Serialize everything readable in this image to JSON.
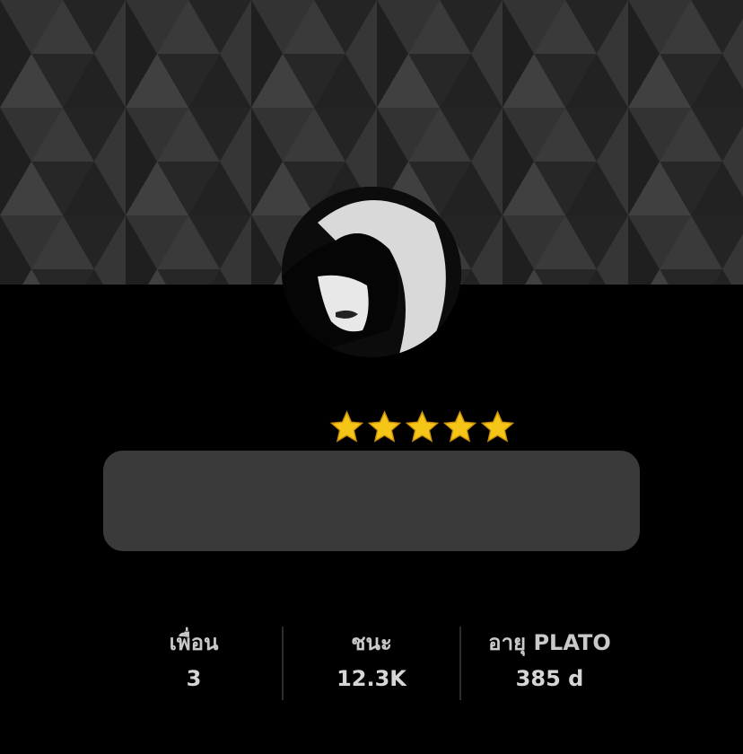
{
  "profile": {
    "rating_stars": 5,
    "star_icon": "star-icon",
    "star_color": "#f5c518",
    "status_text": ""
  },
  "stats": [
    {
      "label": "เพื่อน",
      "value": "3"
    },
    {
      "label": "ชนะ",
      "value": "12.3K"
    },
    {
      "label": "อายุ PLATO",
      "value": "385 d"
    }
  ],
  "colors": {
    "background": "#000000",
    "banner": "#2a2a2a",
    "status_box": "#3a3a3a"
  }
}
